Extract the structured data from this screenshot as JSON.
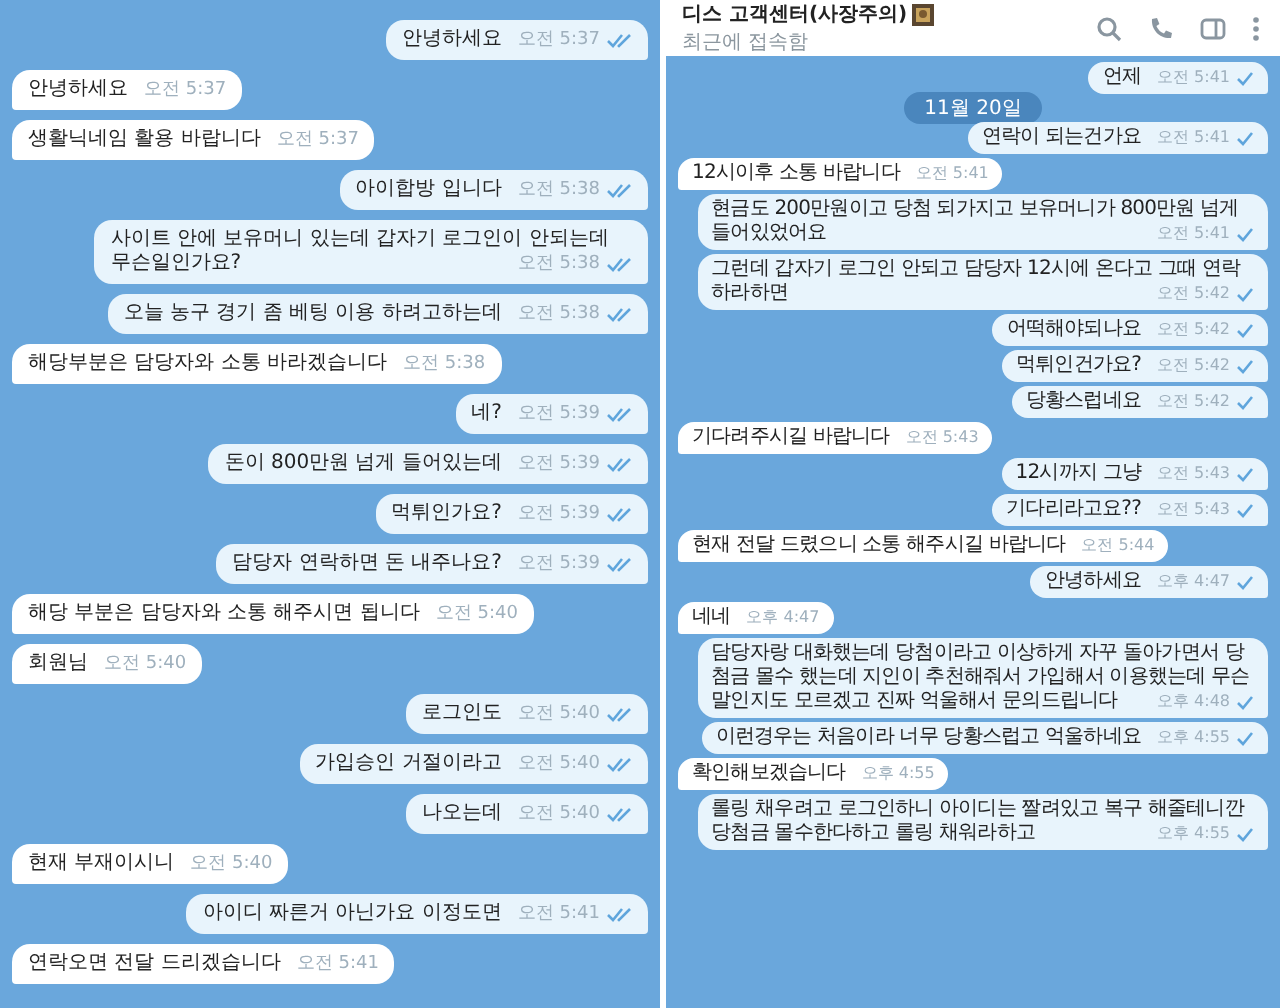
{
  "panels": [
    {
      "messages": [
        {
          "kind": "out",
          "text": "안녕하세요",
          "time": "오전 5:37",
          "read": true
        },
        {
          "kind": "in",
          "text": "안녕하세요",
          "time": "오전 5:37"
        },
        {
          "kind": "in",
          "text": "생활닉네임 활용 바랍니다",
          "time": "오전 5:37"
        },
        {
          "kind": "out",
          "text": "아이합방 입니다",
          "time": "오전 5:38",
          "read": true
        },
        {
          "kind": "out",
          "text": "사이트 안에 보유머니 있는데 갑자기 로그인이 안되는데 무슨일인가요?",
          "time": "오전 5:38",
          "read": true
        },
        {
          "kind": "out",
          "text": "오늘 농구 경기 좀 베팅 이용 하려고하는데",
          "time": "오전 5:38",
          "read": true
        },
        {
          "kind": "in",
          "text": "해당부분은 담당자와 소통 바라겠습니다",
          "time": "오전 5:38"
        },
        {
          "kind": "out",
          "text": "네?",
          "time": "오전 5:39",
          "read": true
        },
        {
          "kind": "out",
          "text": "돈이 800만원 넘게 들어있는데",
          "time": "오전 5:39",
          "read": true
        },
        {
          "kind": "out",
          "text": "먹튀인가요?",
          "time": "오전 5:39",
          "read": true
        },
        {
          "kind": "out",
          "text": "담당자 연락하면 돈 내주나요?",
          "time": "오전 5:39",
          "read": true
        },
        {
          "kind": "in",
          "text": "해당 부분은 담당자와 소통 해주시면 됩니다",
          "time": "오전 5:40"
        },
        {
          "kind": "in",
          "text": "회원님",
          "time": "오전 5:40"
        },
        {
          "kind": "out",
          "text": "로그인도",
          "time": "오전 5:40",
          "read": true
        },
        {
          "kind": "out",
          "text": "가입승인 거절이라고",
          "time": "오전 5:40",
          "read": true
        },
        {
          "kind": "out",
          "text": "나오는데",
          "time": "오전 5:40",
          "read": true
        },
        {
          "kind": "in",
          "text": "현재 부재이시니",
          "time": "오전 5:40"
        },
        {
          "kind": "out",
          "text": "아이디 짜른거 아닌가요 이정도면",
          "time": "오전 5:41",
          "read": true
        },
        {
          "kind": "in",
          "text": "연락오면 전달 드리겠습니다",
          "time": "오전 5:41"
        }
      ]
    },
    {
      "header": {
        "name": "디스 고객센터(사장주의)",
        "status": "최근에 접속함"
      },
      "messages": [
        {
          "kind": "out",
          "text": "언제",
          "time": "오전 5:41",
          "read": false
        },
        {
          "kind": "date",
          "text": "11월 20일"
        },
        {
          "kind": "out",
          "text": "연락이 되는건가요",
          "time": "오전 5:41",
          "read": false
        },
        {
          "kind": "in",
          "text": "12시이후 소통 바랍니다",
          "time": "오전 5:41"
        },
        {
          "kind": "out",
          "text": "현금도 200만원이고 당첨 되가지고 보유머니가 800만원 넘게 들어있었어요",
          "time": "오전 5:41",
          "read": false
        },
        {
          "kind": "out",
          "text": "그런데 갑자기 로그인 안되고 담당자 12시에 온다고 그때 연락하라하면",
          "time": "오전 5:42",
          "read": false
        },
        {
          "kind": "out",
          "text": "어떡해야되나요",
          "time": "오전 5:42",
          "read": false
        },
        {
          "kind": "out",
          "text": "먹튀인건가요?",
          "time": "오전 5:42",
          "read": false
        },
        {
          "kind": "out",
          "text": "당황스럽네요",
          "time": "오전 5:42",
          "read": false
        },
        {
          "kind": "in",
          "text": "기다려주시길 바랍니다",
          "time": "오전 5:43"
        },
        {
          "kind": "out",
          "text": "12시까지 그냥",
          "time": "오전 5:43",
          "read": false
        },
        {
          "kind": "out",
          "text": "기다리라고요??",
          "time": "오전 5:43",
          "read": false
        },
        {
          "kind": "in",
          "text": "현재 전달 드렸으니 소통 해주시길 바랍니다",
          "time": "오전 5:44"
        },
        {
          "kind": "out",
          "text": "안녕하세요",
          "time": "오후 4:47",
          "read": false
        },
        {
          "kind": "in",
          "text": "네네",
          "time": "오후 4:47"
        },
        {
          "kind": "out",
          "text": "담당자랑 대화했는데 당첨이라고 이상하게 자꾸 돌아가면서 당첨금 몰수 했는데 지인이 추천해줘서 가입해서 이용했는데 무슨 말인지도 모르겠고 진짜 억울해서 문의드립니다",
          "time": "오후 4:48",
          "read": false
        },
        {
          "kind": "out",
          "text": "이런경우는 처음이라 너무 당황스럽고 억울하네요",
          "time": "오후 4:55",
          "read": false
        },
        {
          "kind": "in",
          "text": "확인해보겠습니다",
          "time": "오후 4:55"
        },
        {
          "kind": "out",
          "text": "롤링 채우려고 로그인하니 아이디는 짤려있고 복구 해줄테니깐 당첨금 몰수한다하고 롤링 채워라하고",
          "time": "오후 4:55",
          "read": false
        }
      ]
    }
  ]
}
